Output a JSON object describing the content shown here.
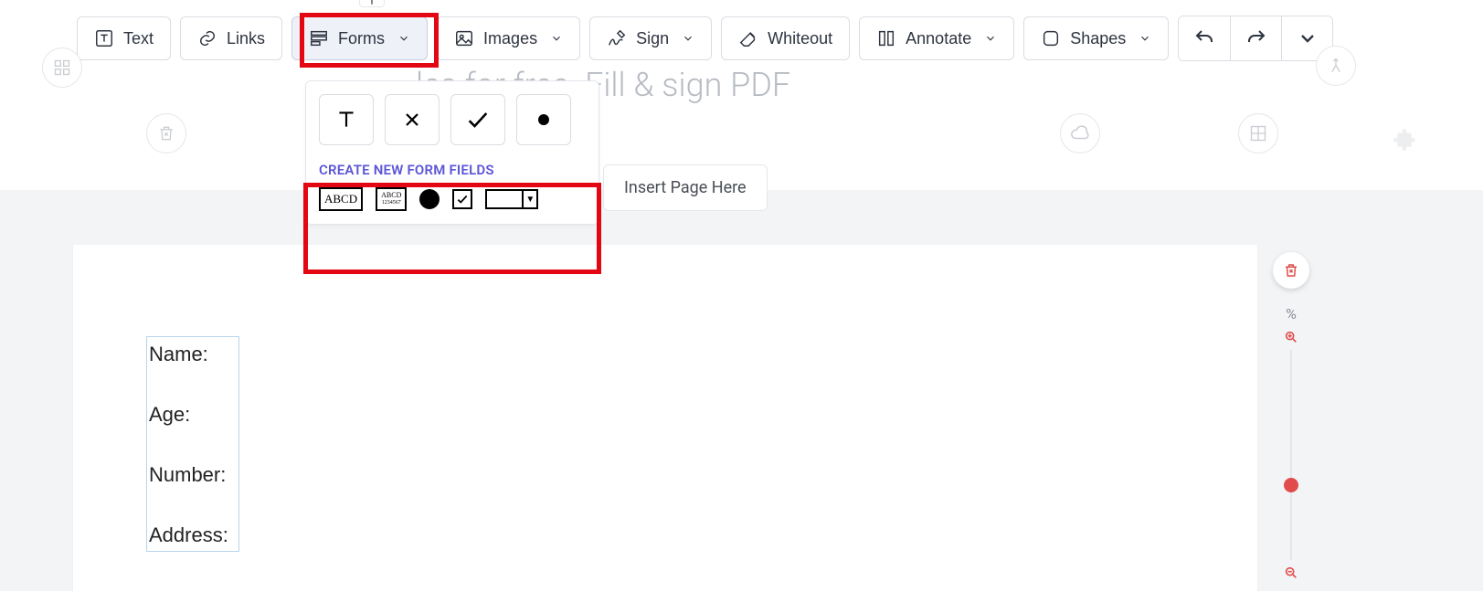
{
  "toolbar": {
    "text": "Text",
    "links": "Links",
    "forms": "Forms",
    "images": "Images",
    "sign": "Sign",
    "whiteout": "Whiteout",
    "annotate": "Annotate",
    "shapes": "Shapes"
  },
  "faded_title_suffix": "les for free. Fill & sign PDF",
  "forms_dropdown": {
    "create_label": "CREATE NEW FORM FIELDS",
    "text_field_label": "ABCD",
    "number_field_top": "ABCD",
    "number_field_bottom": "1234567"
  },
  "insert_page_popover": "Insert Page Here",
  "right_controls": {
    "percent_symbol": "%"
  },
  "document": {
    "fields": [
      "Name:",
      "Age:",
      "Number:",
      "Address:"
    ]
  }
}
